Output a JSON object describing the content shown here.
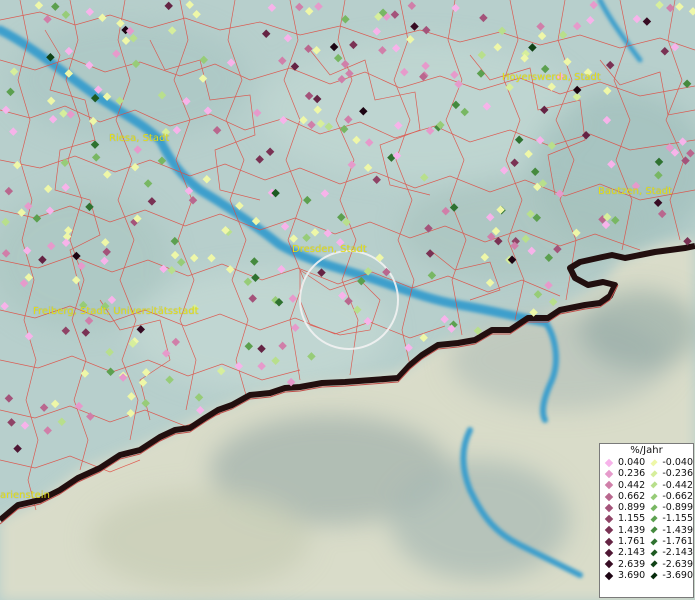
{
  "cities": [
    {
      "id": "hoyerswerda",
      "name": "Hoyerswerda, Stadt"
    },
    {
      "id": "riesa",
      "name": "Riesa, Stadt"
    },
    {
      "id": "bautzen",
      "name": "Bautzen, Stadt"
    },
    {
      "id": "dresden",
      "name": "Dresden, Stadt"
    },
    {
      "id": "freiberg",
      "name": "Freiberg, Stadt; Universitätsstadt"
    },
    {
      "id": "marienstein",
      "name": "arienstein"
    }
  ],
  "legend": {
    "unit": "%/Jahr",
    "classes": [
      {
        "pos": "0.040",
        "neg": "-0.040",
        "pos_color": "#f7b3ea",
        "neg_color": "#eef7a8"
      },
      {
        "pos": "0.236",
        "neg": "-0.236",
        "pos_color": "#e69acb",
        "neg_color": "#d6ee9c"
      },
      {
        "pos": "0.442",
        "neg": "-0.442",
        "pos_color": "#d07fa9",
        "neg_color": "#b8df8c"
      },
      {
        "pos": "0.662",
        "neg": "-0.662",
        "pos_color": "#b9678e",
        "neg_color": "#97cc78"
      },
      {
        "pos": "0.899",
        "neg": "-0.899",
        "pos_color": "#a4537a",
        "neg_color": "#78b763"
      },
      {
        "pos": "1.155",
        "neg": "-1.155",
        "pos_color": "#8f4366",
        "neg_color": "#5ca04f"
      },
      {
        "pos": "1.439",
        "neg": "-1.439",
        "pos_color": "#7a3254",
        "neg_color": "#458a3e"
      },
      {
        "pos": "1.761",
        "neg": "-1.761",
        "pos_color": "#652444",
        "neg_color": "#2f7230"
      },
      {
        "pos": "2.143",
        "neg": "-2.143",
        "pos_color": "#4f1734",
        "neg_color": "#1e5a22"
      },
      {
        "pos": "2.639",
        "neg": "-2.639",
        "pos_color": "#370c23",
        "neg_color": "#114316"
      },
      {
        "pos": "3.690",
        "neg": "-3.690",
        "pos_color": "#1c0412",
        "neg_color": "#062a0b"
      }
    ]
  }
}
